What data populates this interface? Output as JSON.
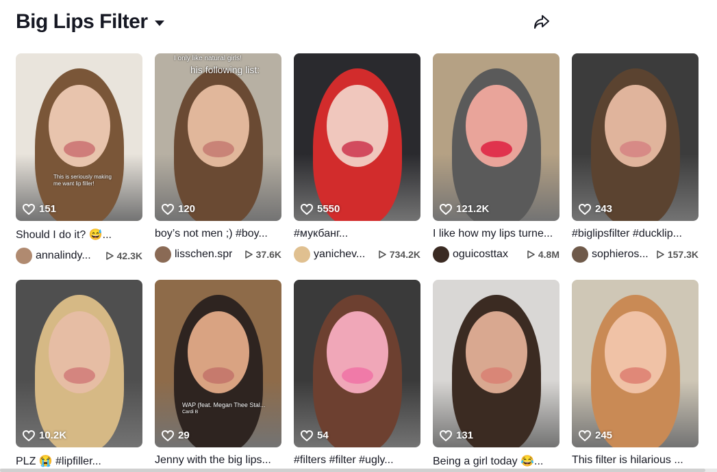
{
  "header": {
    "title": "Big Lips Filter"
  },
  "videos": [
    {
      "likes": "151",
      "caption": "Should I do it? 😅...",
      "author": "annalindy...",
      "views": "42.3K",
      "overlay": [
        "This is seriously making",
        "me want lip filler!"
      ],
      "bg": "#e9e4dc",
      "skin": "#e8c4ad",
      "hair": "#7a5638",
      "lip": "#cf7d7a",
      "avatar": "#b08a70"
    },
    {
      "likes": "120",
      "caption": "boy’s not men ;) #boy...",
      "author": "lisschen.spr",
      "views": "37.6K",
      "overlay": [
        "I only like natural girls!",
        "his following list:"
      ],
      "bg": "#b7b0a3",
      "skin": "#e1b79b",
      "hair": "#6a4a33",
      "lip": "#c98377",
      "avatar": "#8a6a55"
    },
    {
      "likes": "5550",
      "caption": "#мукбанг...",
      "author": "yanichev...",
      "views": "734.2K",
      "overlay": [],
      "bg": "#2a2a2e",
      "skin": "#f0c7bd",
      "hair": "#d22c2c",
      "lip": "#d24b5e",
      "avatar": "#e0c090"
    },
    {
      "likes": "121.2K",
      "caption": "I like how my lips turne...",
      "author": "oguicosttax",
      "views": "4.8M",
      "overlay": [],
      "bg": "#b5a184",
      "skin": "#e9a49a",
      "hair": "#5a5a5a",
      "lip": "#e0334d",
      "avatar": "#3a2a22"
    },
    {
      "likes": "243",
      "caption": "#biglipsfilter #ducklip...",
      "author": "sophieros...",
      "views": "157.3K",
      "overlay": [],
      "bg": "#3c3c3c",
      "skin": "#e0b49c",
      "hair": "#5b4330",
      "lip": "#d78a86",
      "avatar": "#6f5a4a"
    },
    {
      "likes": "10.2K",
      "caption": "PLZ 😭 #lipfiller...",
      "author": "",
      "views": "",
      "overlay": [],
      "bg": "#4f4f4f",
      "skin": "#e6bda4",
      "hair": "#d6b985",
      "lip": "#d4857f",
      "avatar": "#999"
    },
    {
      "likes": "29",
      "caption": "Jenny with the big lips...",
      "author": "",
      "views": "",
      "overlay": [
        "WAP (feat. Megan Thee Stal...",
        "Cardi B"
      ],
      "bg": "#8e6b49",
      "skin": "#d9a382",
      "hair": "#2e2420",
      "lip": "#c67a6d",
      "avatar": "#999"
    },
    {
      "likes": "54",
      "caption": "#filters #filter #ugly...",
      "author": "",
      "views": "",
      "overlay": [],
      "bg": "#3a3a3a",
      "skin": "#f0a7b8",
      "hair": "#6d4030",
      "lip": "#f07aa8",
      "avatar": "#999"
    },
    {
      "likes": "131",
      "caption": "Being a girl today 😂...",
      "author": "",
      "views": "",
      "overlay": [],
      "bg": "#d9d7d5",
      "skin": "#d9a890",
      "hair": "#3b2b22",
      "lip": "#d98677",
      "avatar": "#999"
    },
    {
      "likes": "245",
      "caption": "This filter is hilarious ...",
      "author": "",
      "views": "",
      "overlay": [],
      "bg": "#cfc7b6",
      "skin": "#f0c2a6",
      "hair": "#c98a55",
      "lip": "#e08878",
      "avatar": "#999"
    }
  ]
}
